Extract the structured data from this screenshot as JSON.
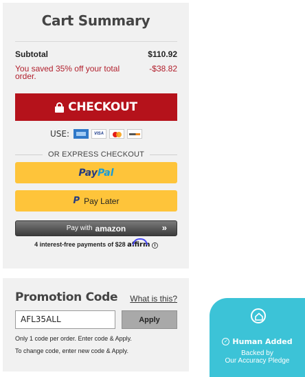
{
  "cart": {
    "title": "Cart Summary",
    "subtotal_label": "Subtotal",
    "subtotal_value": "$110.92",
    "savings_label": "You saved 35% off your total order.",
    "savings_value": "-$38.82",
    "checkout_label": "CHECKOUT",
    "use_label": "USE:",
    "cards": [
      "amex-card-icon",
      "visa-card-icon",
      "mastercard-icon",
      "discover-card-icon"
    ],
    "card_visa_text": "VISA",
    "express_label": "OR EXPRESS CHECKOUT",
    "paypal_a": "Pay",
    "paypal_b": "Pal",
    "paylater_label": "Pay Later",
    "paylater_logo": "P",
    "amazon_prefix": "Pay with",
    "amazon_brand": "amazon",
    "amazon_arrow": "»",
    "affirm_text": "4 interest-free payments of $28",
    "affirm_brand": "affirm",
    "info_glyph": "i",
    "colors": {
      "panel": "#f1f1f1",
      "checkout": "#b5121b",
      "savings": "#b11e2b",
      "paypal_button": "#fec43a",
      "paypal_dark": "#253b80",
      "paypal_light": "#179bd7"
    }
  },
  "promo": {
    "title": "Promotion Code",
    "help_link": "What is this?",
    "input_value": "AFL35ALL",
    "apply_label": "Apply",
    "note1": "Only 1 code per order. Enter code & Apply.",
    "note2": "To change code, enter new code & Apply."
  },
  "badge": {
    "icon": "home-icon",
    "title": "Human Added",
    "check_glyph": "✓",
    "line1": "Backed by",
    "line2": "Our Accuracy Pledge",
    "color": "#3cc3d7"
  }
}
